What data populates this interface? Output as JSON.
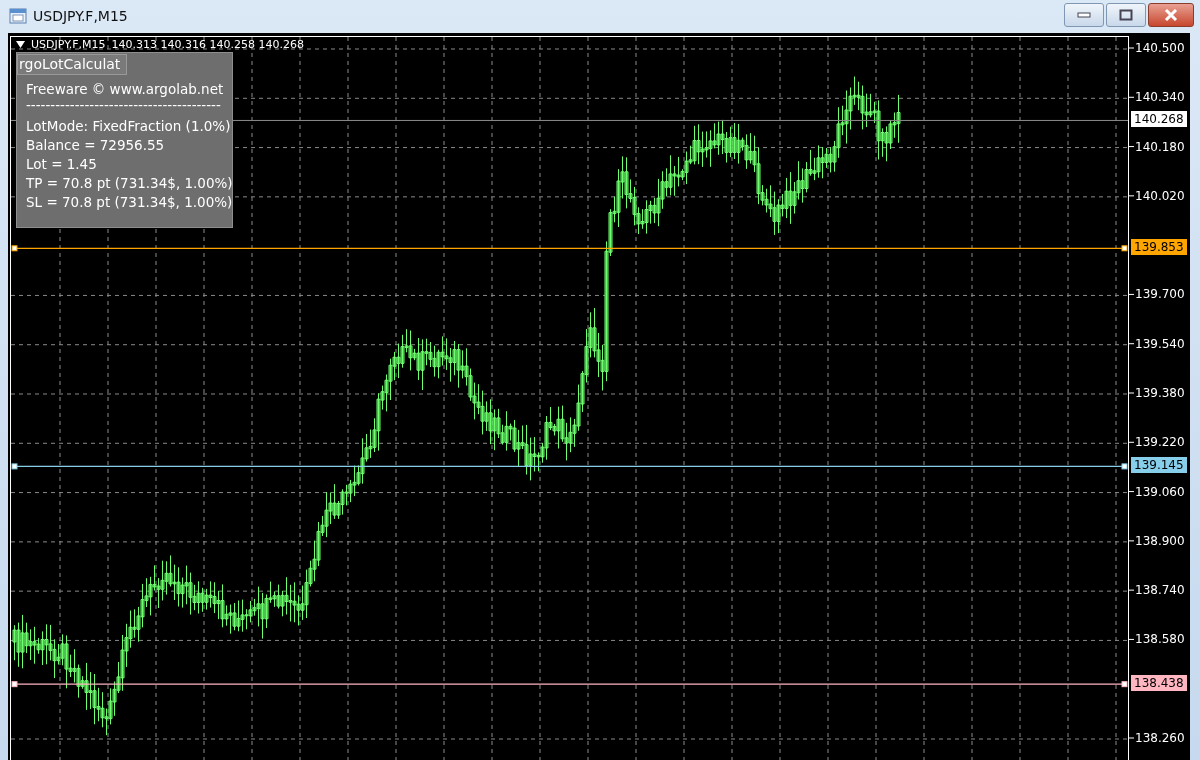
{
  "window": {
    "title": "USDJPY.F,M15"
  },
  "chart": {
    "symbol": "USDJPY.F,M15",
    "ohlc": "140.313 140.316 140.258 140.268",
    "price_axis": [
      "140.500",
      "140.340",
      "140.180",
      "140.020",
      "139.700",
      "139.540",
      "139.380",
      "139.220",
      "139.060",
      "138.900",
      "138.740",
      "138.580",
      "138.260"
    ],
    "price_lines": [
      {
        "kind": "bid",
        "price": "140.268",
        "color": "#ffffff"
      },
      {
        "kind": "level",
        "price": "139.853",
        "color": "#ffa500"
      },
      {
        "kind": "level",
        "price": "139.145",
        "color": "#87ceeb"
      },
      {
        "kind": "level",
        "price": "138.438",
        "color": "#ffb6c1"
      }
    ]
  },
  "panel": {
    "title": "rgoLotCalculat",
    "lines": [
      "Freeware © www.argolab.net",
      "----------------------------------------",
      "LotMode: FixedFraction (1.0%)",
      "Balance = 72956.55",
      "Lot = 1.45",
      "TP = 70.8 pt (731.34$, 1.00%)",
      "SL = 70.8 pt (731.34$, 1.00%)"
    ]
  }
}
